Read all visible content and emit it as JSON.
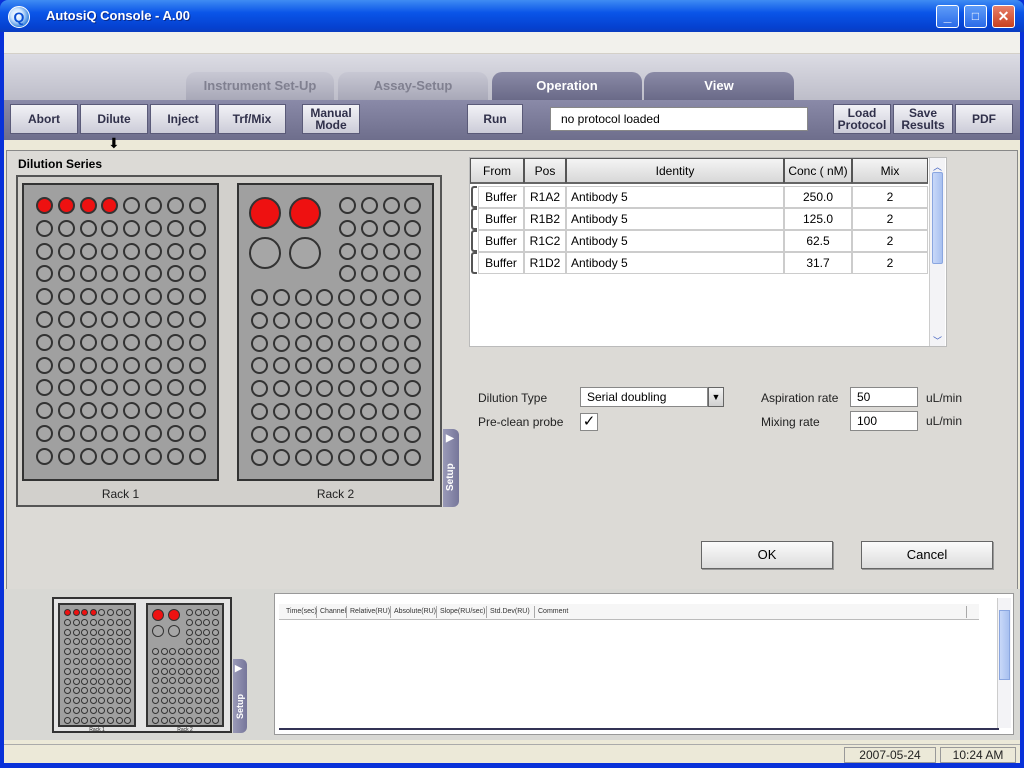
{
  "window": {
    "title": "AutosiQ Console - A.00"
  },
  "tabs": [
    {
      "label": "Instrument Set-Up"
    },
    {
      "label": "Assay-Setup"
    },
    {
      "label": "Operation"
    },
    {
      "label": "View"
    }
  ],
  "active_tab": "Operation",
  "toolbar": {
    "abort": "Abort",
    "dilute": "Dilute",
    "inject": "Inject",
    "trf_mix": "Trf/Mix",
    "manual_mode": "Manual Mode",
    "run": "Run",
    "protocol_status": "no protocol loaded",
    "load_protocol": "Load Protocol",
    "save_results": "Save Results",
    "pdf": "PDF"
  },
  "dilution": {
    "title": "Dilution Series",
    "rack1_label": "Rack 1",
    "rack2_label": "Rack 2",
    "setup_label": "Setup",
    "rack1_red_count": 4,
    "rack2_red_count": 2,
    "columns": [
      "From",
      "Pos",
      "Identity",
      "Conc ( nM)",
      "Mix"
    ],
    "rows": [
      {
        "from": "Buffer",
        "pos": "R1A2",
        "identity": "Antibody 5",
        "conc": "250.0",
        "mix": "2"
      },
      {
        "from": "Buffer",
        "pos": "R1B2",
        "identity": "Antibody 5",
        "conc": "125.0",
        "mix": "2"
      },
      {
        "from": "Buffer",
        "pos": "R1C2",
        "identity": "Antibody 5",
        "conc": "62.5",
        "mix": "2"
      },
      {
        "from": "Buffer",
        "pos": "R1D2",
        "identity": "Antibody 5",
        "conc": "31.7",
        "mix": "2"
      }
    ],
    "dilution_type_label": "Dilution Type",
    "dilution_type_value": "Serial doubling",
    "preclean_label": "Pre-clean probe",
    "preclean_checked": true,
    "aspiration_label": "Aspiration rate",
    "aspiration_value": "50",
    "aspiration_unit": "uL/min",
    "mixing_label": "Mixing rate",
    "mixing_value": "100",
    "mixing_unit": "uL/min",
    "ok": "OK",
    "cancel": "Cancel"
  },
  "mini": {
    "rack1_label": "Rack 1",
    "rack2_label": "Rack 2",
    "setup_label": "Setup"
  },
  "log": {
    "columns": [
      "Time(sec)",
      "Channel",
      "Relative(RU)",
      "Absolute(RU)",
      "Slope(RU/sec)",
      "Std.Dev(RU)",
      "Comment"
    ]
  },
  "status": {
    "date": "2007-05-24",
    "time": "10:24 AM"
  }
}
